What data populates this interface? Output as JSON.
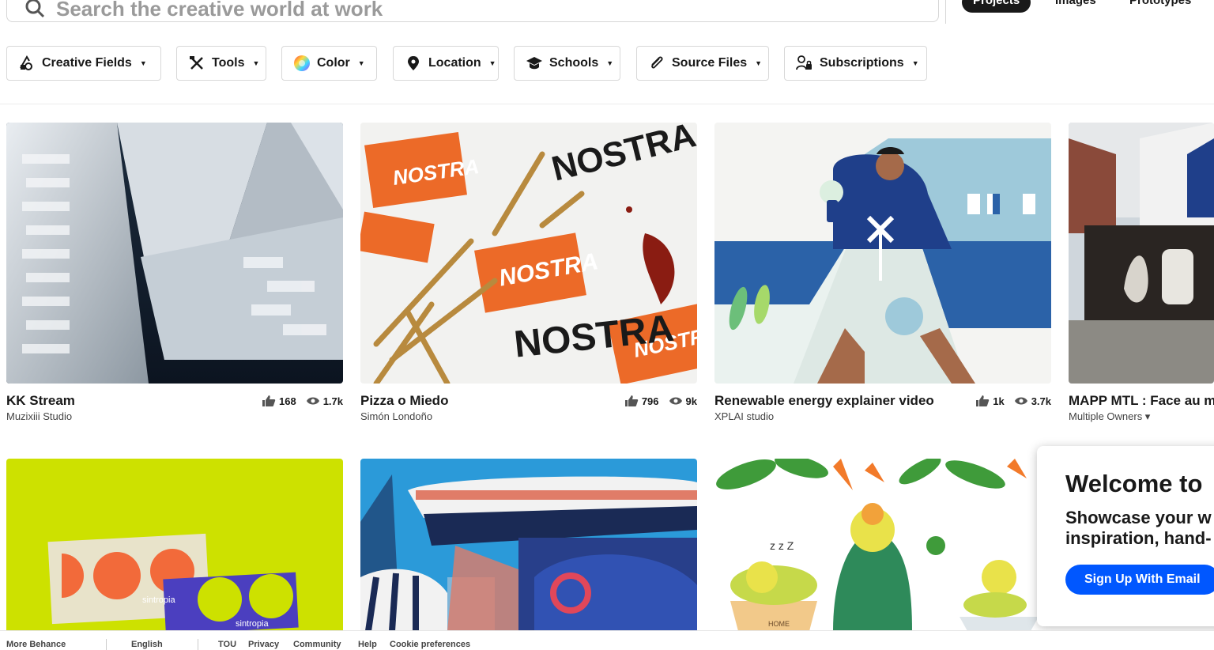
{
  "search": {
    "placeholder": "Search the creative world at work",
    "tabs": [
      "Projects",
      "Images",
      "Prototypes"
    ]
  },
  "filters": [
    {
      "label": "Creative Fields",
      "icon": "creative-fields-icon"
    },
    {
      "label": "Tools",
      "icon": "tools-icon"
    },
    {
      "label": "Color",
      "icon": "color-wheel-icon"
    },
    {
      "label": "Location",
      "icon": "location-pin-icon"
    },
    {
      "label": "Schools",
      "icon": "graduation-cap-icon"
    },
    {
      "label": "Source Files",
      "icon": "paperclip-icon"
    },
    {
      "label": "Subscriptions",
      "icon": "subscriptions-icon"
    }
  ],
  "projects": [
    {
      "title": "KK Stream",
      "owner": "Muzixiii Studio",
      "likes": "168",
      "views": "1.7k"
    },
    {
      "title": "Pizza o Miedo",
      "owner": "Simón Londoño",
      "likes": "796",
      "views": "9k"
    },
    {
      "title": "Renewable energy explainer video",
      "owner": "XPLAI studio",
      "likes": "1k",
      "views": "3.7k"
    },
    {
      "title": "MAPP MTL : Face au m",
      "owner": "Multiple Owners ▾",
      "likes": "",
      "views": ""
    }
  ],
  "thumb_text": {
    "nostra": "NOSTRA",
    "sintropia": "sintropia",
    "home": "HOME",
    "zzz": "z z Z"
  },
  "welcome": {
    "title": "Welcome to",
    "text": "Showcase your w inspiration, hand-",
    "button": "Sign Up With Email"
  },
  "footer": [
    "More Behance",
    "English",
    "TOU",
    "Privacy",
    "Community",
    "Help",
    "Cookie preferences"
  ],
  "colors": {
    "accent": "#0057ff",
    "dark": "#191919"
  }
}
